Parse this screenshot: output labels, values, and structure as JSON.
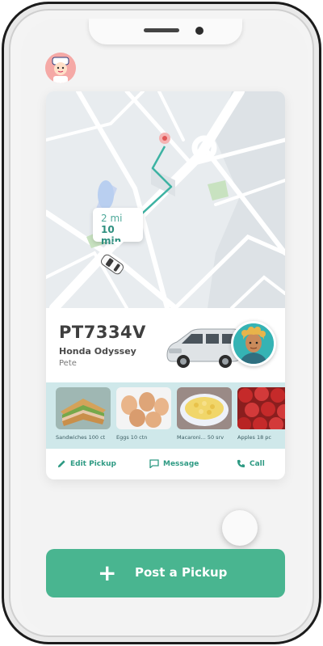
{
  "app": {
    "accent": "#49b590",
    "map_route_color": "#3db3a3"
  },
  "trip": {
    "distance": "2 mi",
    "eta": "10 min"
  },
  "vehicle": {
    "plate": "PT7334V",
    "model": "Honda Odyssey",
    "driver": "Pete"
  },
  "items": [
    {
      "label": "Sandwiches 100 ct",
      "icon": "sandwich-image"
    },
    {
      "label": "Eggs 10 ctn",
      "icon": "eggs-image"
    },
    {
      "label": "Macaroni... 50 srv",
      "icon": "macaroni-image"
    },
    {
      "label": "Apples 18 pc",
      "icon": "apples-image"
    }
  ],
  "actions": {
    "edit": "Edit Pickup",
    "message": "Message",
    "call": "Call"
  },
  "post_button": {
    "icon": "+",
    "label": "Post a Pickup"
  }
}
